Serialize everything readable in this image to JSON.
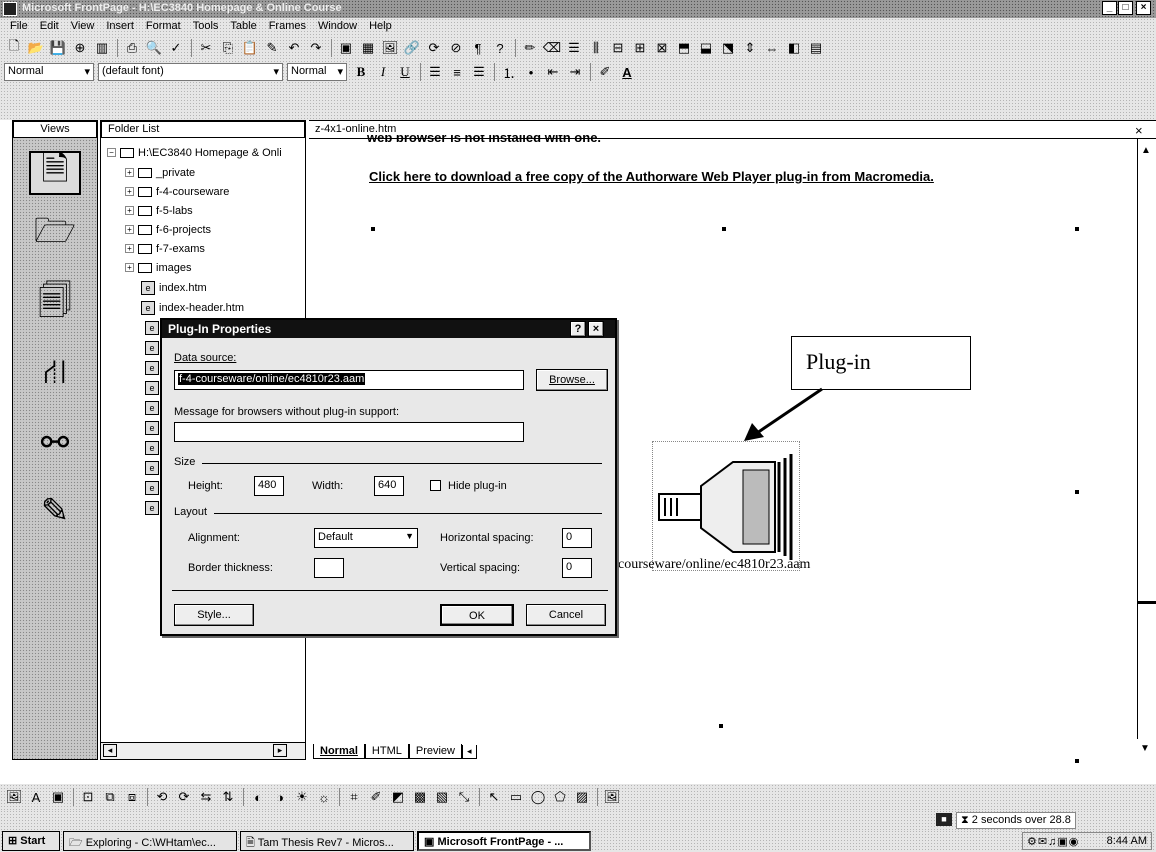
{
  "window": {
    "title": "Microsoft FrontPage - H:\\EC3840 Homepage & Online Course",
    "min_label": "_",
    "max_label": "□",
    "close_label": "×"
  },
  "menu": [
    "File",
    "Edit",
    "View",
    "Insert",
    "Format",
    "Tools",
    "Table",
    "Frames",
    "Window",
    "Help"
  ],
  "format_bar": {
    "style": "Normal",
    "font": "(default font)",
    "size": "Normal",
    "bold": "B",
    "italic": "I",
    "underline": "U"
  },
  "views_panel": {
    "header": "Views"
  },
  "folder_panel": {
    "header": "Folder List",
    "root": "H:\\EC3840 Homepage & Onli",
    "folders": [
      "_private",
      "f-4-courseware",
      "f-5-labs",
      "f-6-projects",
      "f-7-exams",
      "images"
    ],
    "files": [
      "index.htm",
      "index-header.htm"
    ]
  },
  "editor": {
    "file_tab": "z-4x1-online.htm",
    "close_label": "×",
    "truncated_text": "web browser is not installed with one.",
    "download_link": "Click here to download a free copy of the Authorware Web Player plug-in from Macromedia.",
    "plugin_path_text": "courseware/online/ec4810r23.aam",
    "callout_label": "Plug-in",
    "view_tabs": [
      "Normal",
      "HTML",
      "Preview"
    ]
  },
  "dialog": {
    "title": "Plug-In Properties",
    "help_label": "?",
    "close_label": "×",
    "data_source_label": "Data source:",
    "data_source_value": "f-4-courseware/online/ec4810r23.aam",
    "browse_label": "Browse...",
    "message_label": "Message for browsers without plug-in support:",
    "message_value": "",
    "size_group": "Size",
    "height_label": "Height:",
    "height_value": "480",
    "width_label": "Width:",
    "width_value": "640",
    "hide_plugin_label": "Hide plug-in",
    "layout_group": "Layout",
    "alignment_label": "Alignment:",
    "alignment_value": "Default",
    "border_label": "Border thickness:",
    "border_value": "",
    "hspace_label": "Horizontal spacing:",
    "hspace_value": "0",
    "vspace_label": "Vertical spacing:",
    "vspace_value": "0",
    "style_label": "Style...",
    "ok_label": "OK",
    "cancel_label": "Cancel"
  },
  "status_bar": {
    "download_time": "2 seconds over 28.8"
  },
  "taskbar": {
    "start_label": "Start",
    "tasks": [
      "Exploring - C:\\WHtam\\ec...",
      "Tam Thesis Rev7 - Micros...",
      "Microsoft FrontPage - ..."
    ],
    "clock": "8:44 AM"
  }
}
